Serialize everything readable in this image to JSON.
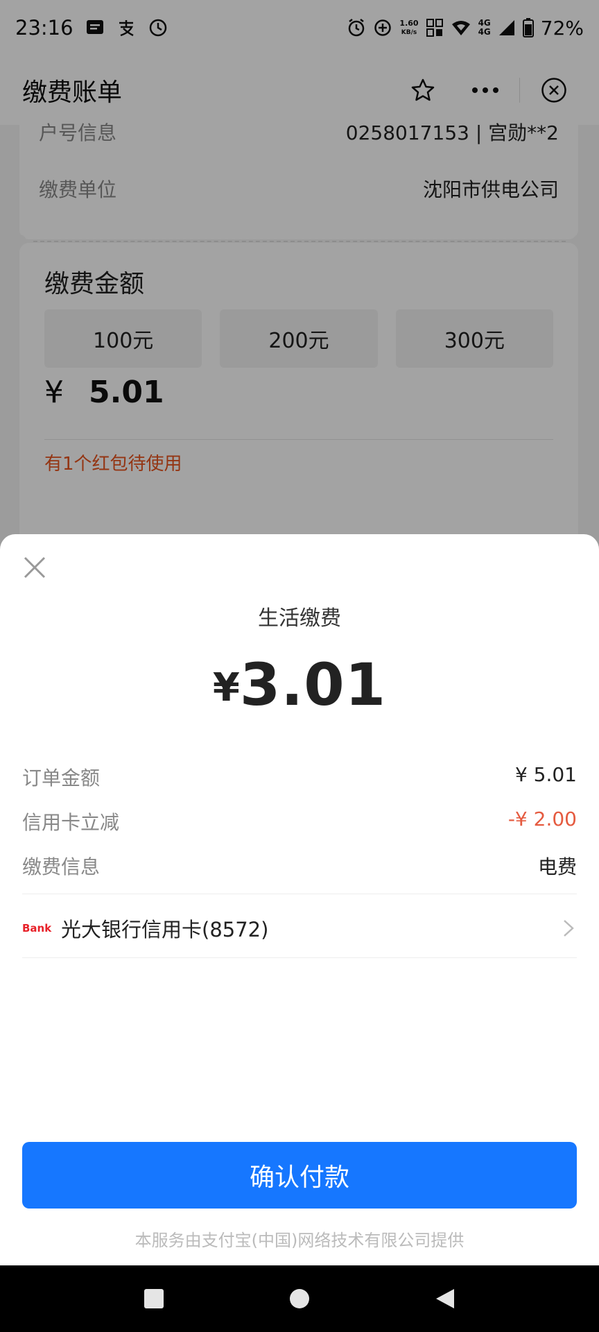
{
  "status_bar": {
    "time": "23:16",
    "net_speed_value": "1.60",
    "net_speed_unit": "KB/s",
    "net_type_1": "4G",
    "net_type_2": "4G",
    "battery": "72%"
  },
  "header": {
    "title": "缴费账单"
  },
  "account": {
    "number_label": "户号信息",
    "number_value": "0258017153 | 宫勋**2",
    "unit_label": "缴费单位",
    "unit_value": "沈阳市供电公司"
  },
  "amount_section": {
    "title": "缴费金额",
    "presets": [
      "100元",
      "200元",
      "300元"
    ],
    "currency": "¥",
    "value": "5.01",
    "red_packet": "有1个红包待使用"
  },
  "sheet": {
    "title": "生活缴费",
    "pay_currency": "¥",
    "pay_amount": "3.01",
    "details": [
      {
        "label": "订单金额",
        "value": "¥ 5.01"
      },
      {
        "label": "信用卡立减",
        "value": "-¥ 2.00"
      },
      {
        "label": "缴费信息",
        "value": "电费"
      }
    ],
    "bank_logo": "Bank",
    "card_name": "光大银行信用卡(8572)",
    "confirm_label": "确认付款",
    "provider": "本服务由支付宝(中国)网络技术有限公司提供"
  },
  "colors": {
    "primary": "#1677ff",
    "discount": "#e55b40",
    "red_packet": "#e8541e"
  }
}
